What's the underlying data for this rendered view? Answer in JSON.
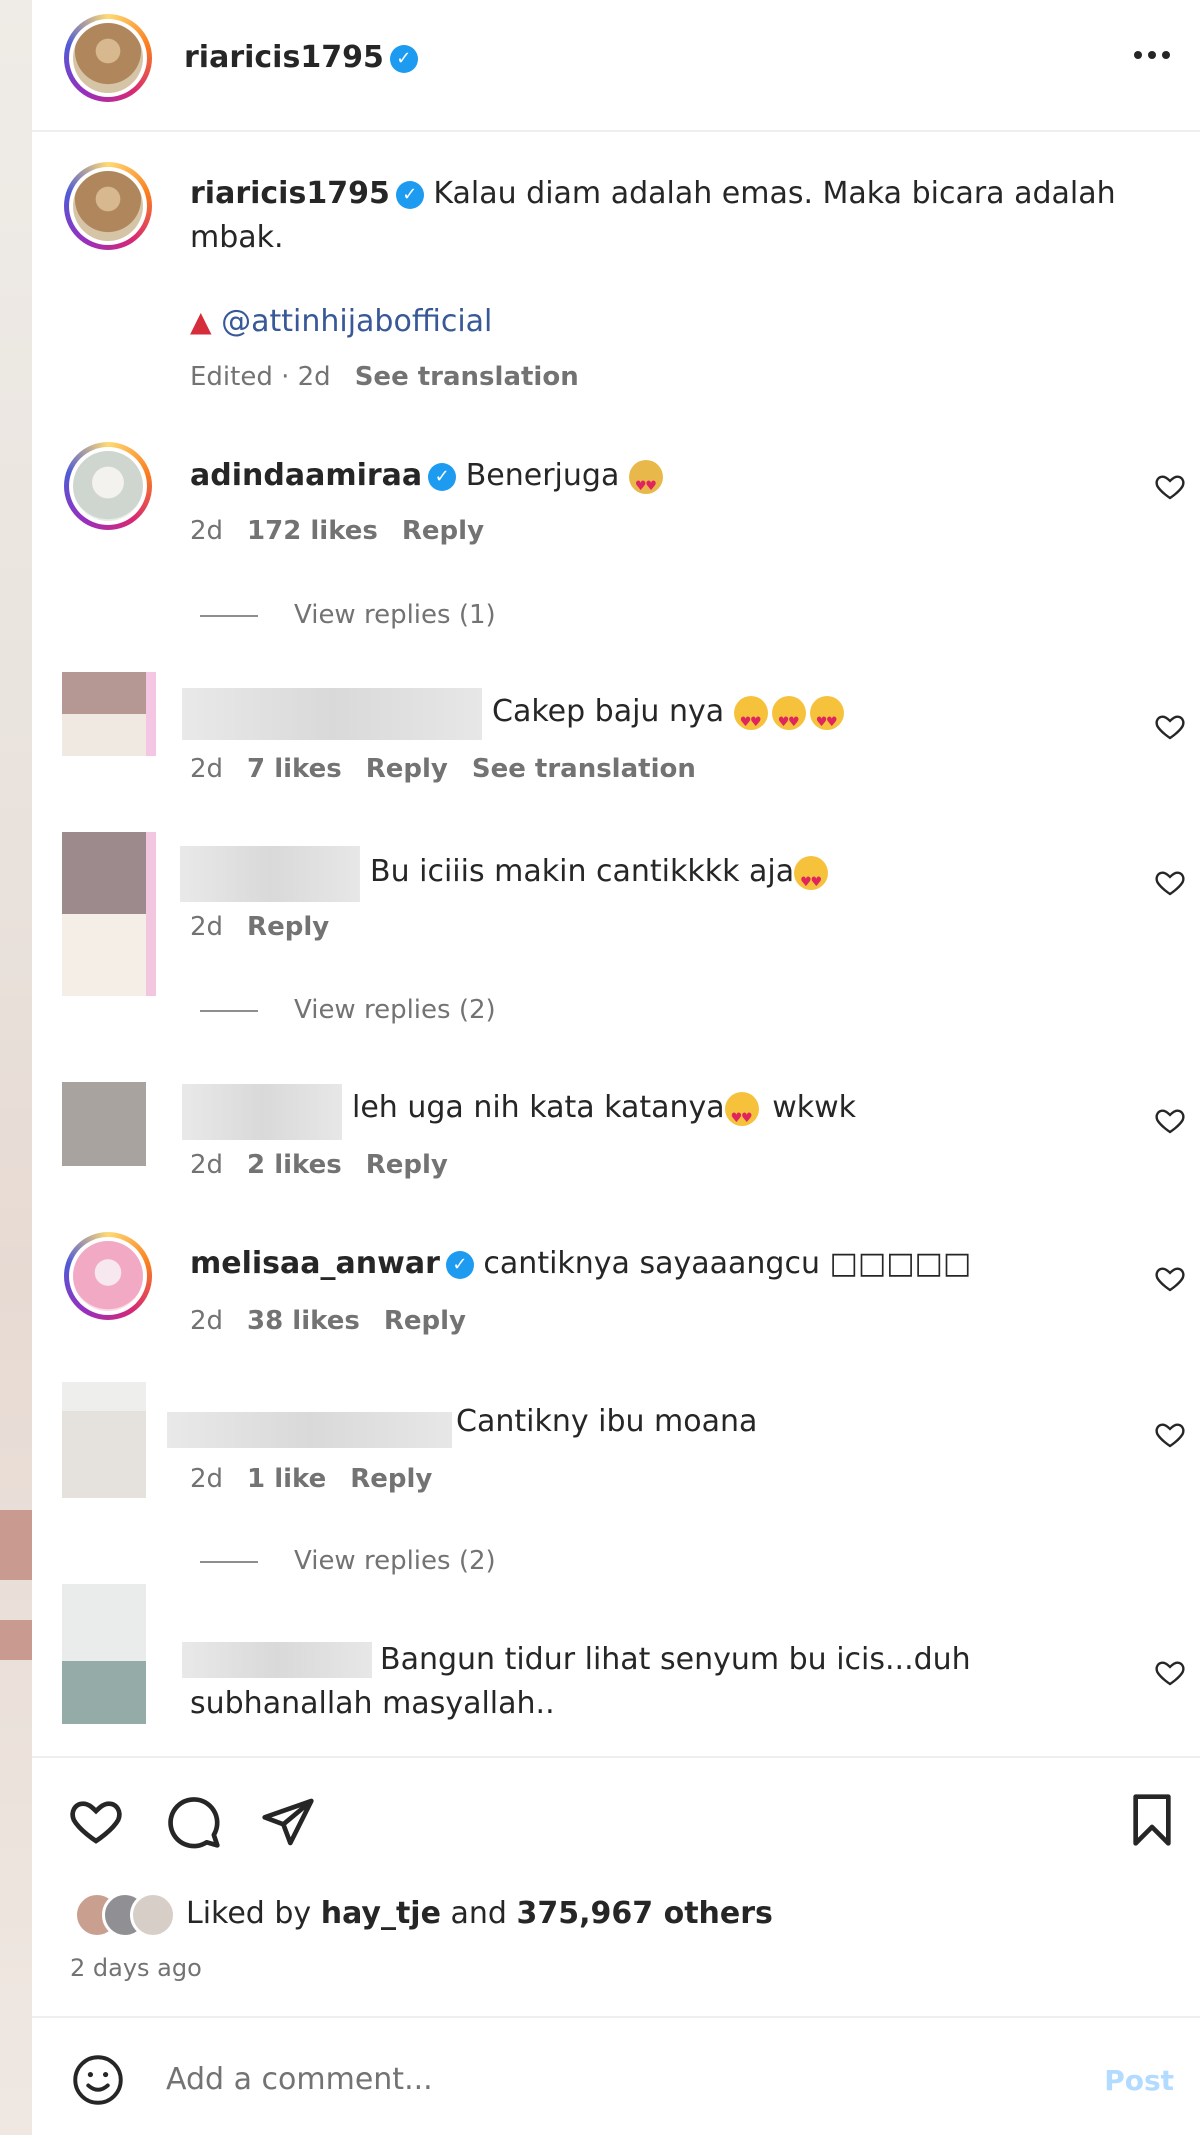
{
  "header": {
    "username": "riaricis1795"
  },
  "caption": {
    "username": "riaricis1795",
    "text": "Kalau diam adalah emas. Maka bicara adalah mbak.",
    "mention": "@attinhijabofficial",
    "edited": "Edited · 2d",
    "see_translation": "See translation"
  },
  "comments": [
    {
      "username": "adindaamiraa",
      "text": "Benerjuga",
      "time": "2d",
      "likes": "172 likes",
      "reply": "Reply",
      "view_replies": "View replies (1)"
    },
    {
      "text": "Cakep baju nya",
      "time": "2d",
      "likes": "7 likes",
      "reply": "Reply",
      "see_translation": "See translation"
    },
    {
      "text": "Bu iciiis makin cantikkkk aja",
      "time": "2d",
      "reply": "Reply",
      "view_replies": "View replies (2)"
    },
    {
      "text": "leh uga nih kata katanya",
      "text_after": "wkwk",
      "time": "2d",
      "likes": "2 likes",
      "reply": "Reply"
    },
    {
      "username": "melisaa_anwar",
      "text": "cantiknya sayaaangcu",
      "text_after": "□□□□□",
      "time": "2d",
      "likes": "38 likes",
      "reply": "Reply"
    },
    {
      "text": "Cantikny ibu moana",
      "time": "2d",
      "likes": "1 like",
      "reply": "Reply",
      "view_replies": "View replies (2)"
    },
    {
      "text": "Bangun tidur lihat senyum bu icis...duh subhanallah masyallah.."
    }
  ],
  "likes_bar": {
    "liked_by": "Liked by",
    "user": "hay_tje",
    "and": "and",
    "others": "375,967 others",
    "time": "2 days ago"
  },
  "comment_box": {
    "placeholder": "Add a comment...",
    "post": "Post"
  },
  "colors": {
    "verified": "#1d9bf0",
    "secondary_text": "#737373",
    "post_disabled": "#b3dbff"
  }
}
